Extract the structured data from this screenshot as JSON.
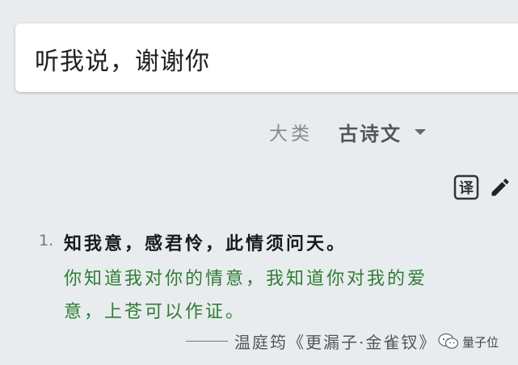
{
  "search": {
    "query": "听我说，谢谢你"
  },
  "category": {
    "label": "大类",
    "selected": "古诗文"
  },
  "toolbar": {
    "translate_icon": "translate-icon",
    "edit_icon": "edit-icon"
  },
  "results": [
    {
      "number": "1.",
      "poem": "知我意，感君怜，此情须问天。",
      "translation": "你知道我对你的情意，我知道你对我的爱意，上苍可以作证。",
      "source": "温庭筠《更漏子·金雀钗》"
    }
  ],
  "watermark": {
    "text": "量子位"
  },
  "colors": {
    "background": "#e9ecef",
    "translation_green": "#2e7d32"
  }
}
